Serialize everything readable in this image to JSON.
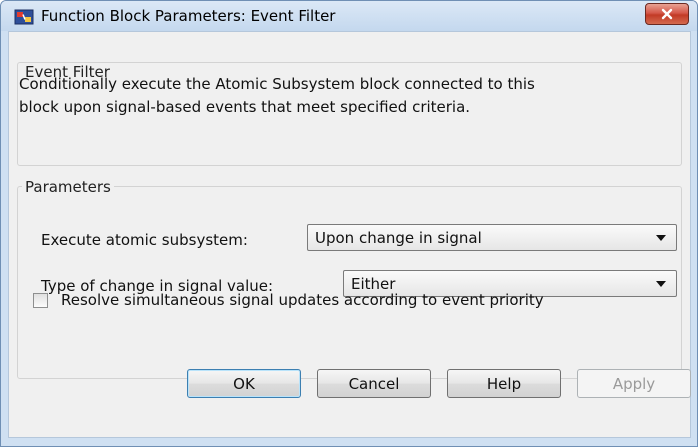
{
  "window": {
    "title": "Function Block Parameters: Event Filter",
    "app_icon": "simulink-block-icon",
    "close_icon": "close-icon",
    "colors": {
      "titlebar": "#c4d8ee",
      "client": "#f0f0f0",
      "close_button": "#c23a26"
    }
  },
  "description_group": {
    "title": "Event Filter",
    "lines": [
      "Conditionally execute the Atomic Subsystem block connected to this",
      "block upon signal-based events that meet specified criteria."
    ]
  },
  "parameters_group": {
    "title": "Parameters",
    "execute_label": "Execute atomic subsystem:",
    "execute_value": "Upon change in signal",
    "change_label": "Type of change in signal value:",
    "change_value": "Either",
    "resolve_label": "Resolve simultaneous signal updates according to event priority",
    "resolve_checked": false
  },
  "buttons": {
    "ok": "OK",
    "cancel": "Cancel",
    "help": "Help",
    "apply": "Apply"
  }
}
